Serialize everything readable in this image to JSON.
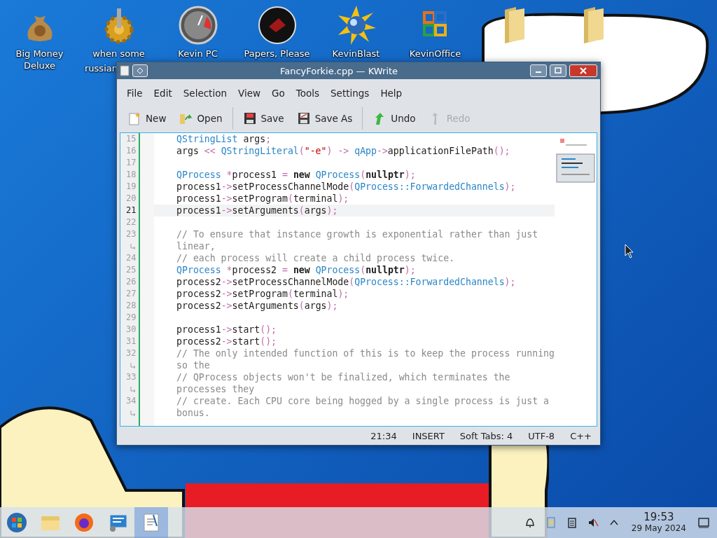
{
  "desktop_icons": [
    {
      "kind": "money-bag",
      "label": "Big Money Deluxe"
    },
    {
      "kind": "gear",
      "label_lines": [
        "when some",
        "russian"
      ]
    },
    {
      "kind": "gauge",
      "label": "Kevin PC"
    },
    {
      "kind": "dark-disc",
      "label": "Papers, Please"
    },
    {
      "kind": "sun-globe",
      "label": "KevinBlast"
    },
    {
      "kind": "office",
      "label": "KevinOffice"
    },
    {
      "kind": "folder"
    },
    {
      "kind": "folder"
    }
  ],
  "window": {
    "title": "FancyForkie.cpp — KWrite",
    "menu": [
      "File",
      "Edit",
      "Selection",
      "View",
      "Go",
      "Tools",
      "Settings",
      "Help"
    ],
    "toolbar": [
      {
        "kind": "new",
        "label": "New",
        "disabled": false
      },
      {
        "kind": "open",
        "label": "Open",
        "disabled": false
      },
      {
        "kind": "save",
        "label": "Save",
        "disabled": false,
        "separator_before": true
      },
      {
        "kind": "save-as",
        "label": "Save As",
        "disabled": false
      },
      {
        "kind": "undo",
        "label": "Undo",
        "disabled": false,
        "separator_before": true
      },
      {
        "kind": "redo",
        "label": "Redo",
        "disabled": true
      }
    ],
    "editor": {
      "lines": [
        {
          "number": "15",
          "current": false,
          "segments": [
            {
              "kind": "type",
              "text": "QStringList"
            },
            {
              "kind": "plain",
              "text": " args"
            },
            {
              "kind": "op",
              "text": ";"
            }
          ]
        },
        {
          "number": "16",
          "current": false,
          "segments": [
            {
              "kind": "plain",
              "text": "args "
            },
            {
              "kind": "op",
              "text": "<< "
            },
            {
              "kind": "type",
              "text": "QStringLiteral"
            },
            {
              "kind": "op",
              "text": "("
            },
            {
              "kind": "string",
              "text": "\"-e\""
            },
            {
              "kind": "op",
              "text": ") -> "
            },
            {
              "kind": "type",
              "text": "qApp"
            },
            {
              "kind": "op",
              "text": "->"
            },
            {
              "kind": "plain",
              "text": "applicationFilePath"
            },
            {
              "kind": "op",
              "text": "();"
            }
          ]
        },
        {
          "number": "17",
          "current": false
        },
        {
          "number": "18",
          "current": false,
          "segments": [
            {
              "kind": "type",
              "text": "QProcess "
            },
            {
              "kind": "op",
              "text": "*"
            },
            {
              "kind": "plain",
              "text": "process1 "
            },
            {
              "kind": "op",
              "text": "= "
            },
            {
              "kind": "keyword",
              "text": "new "
            },
            {
              "kind": "type",
              "text": "QProcess"
            },
            {
              "kind": "op",
              "text": "("
            },
            {
              "kind": "keyword",
              "text": "nullptr"
            },
            {
              "kind": "op",
              "text": ");"
            }
          ]
        },
        {
          "number": "19",
          "current": false,
          "segments": [
            {
              "kind": "plain",
              "text": "process1"
            },
            {
              "kind": "op",
              "text": "->"
            },
            {
              "kind": "plain",
              "text": "setProcessChannelMode"
            },
            {
              "kind": "op",
              "text": "("
            },
            {
              "kind": "type",
              "text": "QProcess::ForwardedChannels"
            },
            {
              "kind": "op",
              "text": ");"
            }
          ]
        },
        {
          "number": "20",
          "current": false,
          "segments": [
            {
              "kind": "plain",
              "text": "process1"
            },
            {
              "kind": "op",
              "text": "->"
            },
            {
              "kind": "plain",
              "text": "setProgram"
            },
            {
              "kind": "op",
              "text": "("
            },
            {
              "kind": "plain",
              "text": "terminal"
            },
            {
              "kind": "op",
              "text": ");"
            }
          ]
        },
        {
          "number": "21",
          "current": true,
          "segments": [
            {
              "kind": "plain",
              "text": "process1"
            },
            {
              "kind": "op",
              "text": "->"
            },
            {
              "kind": "plain",
              "text": "setArguments"
            },
            {
              "kind": "op",
              "text": "("
            },
            {
              "kind": "plain",
              "text": "args"
            },
            {
              "kind": "op",
              "text": ");"
            }
          ]
        },
        {
          "number": "22",
          "current": false
        },
        {
          "number": "23",
          "current": false,
          "segments": [
            {
              "kind": "comment",
              "text": "// To ensure that instance growth is exponential rather than just"
            }
          ],
          "wrap": [
            {
              "kind": "comment",
              "text": "linear,"
            }
          ]
        },
        {
          "number": "24",
          "current": false,
          "segments": [
            {
              "kind": "comment",
              "text": "// each process will create a child process twice."
            }
          ]
        },
        {
          "number": "25",
          "current": false,
          "segments": [
            {
              "kind": "type",
              "text": "QProcess "
            },
            {
              "kind": "op",
              "text": "*"
            },
            {
              "kind": "plain",
              "text": "process2 "
            },
            {
              "kind": "op",
              "text": "= "
            },
            {
              "kind": "keyword",
              "text": "new "
            },
            {
              "kind": "type",
              "text": "QProcess"
            },
            {
              "kind": "op",
              "text": "("
            },
            {
              "kind": "keyword",
              "text": "nullptr"
            },
            {
              "kind": "op",
              "text": ");"
            }
          ]
        },
        {
          "number": "26",
          "current": false,
          "segments": [
            {
              "kind": "plain",
              "text": "process2"
            },
            {
              "kind": "op",
              "text": "->"
            },
            {
              "kind": "plain",
              "text": "setProcessChannelMode"
            },
            {
              "kind": "op",
              "text": "("
            },
            {
              "kind": "type",
              "text": "QProcess::ForwardedChannels"
            },
            {
              "kind": "op",
              "text": ");"
            }
          ]
        },
        {
          "number": "27",
          "current": false,
          "segments": [
            {
              "kind": "plain",
              "text": "process2"
            },
            {
              "kind": "op",
              "text": "->"
            },
            {
              "kind": "plain",
              "text": "setProgram"
            },
            {
              "kind": "op",
              "text": "("
            },
            {
              "kind": "plain",
              "text": "terminal"
            },
            {
              "kind": "op",
              "text": ");"
            }
          ]
        },
        {
          "number": "28",
          "current": false,
          "segments": [
            {
              "kind": "plain",
              "text": "process2"
            },
            {
              "kind": "op",
              "text": "->"
            },
            {
              "kind": "plain",
              "text": "setArguments"
            },
            {
              "kind": "op",
              "text": "("
            },
            {
              "kind": "plain",
              "text": "args"
            },
            {
              "kind": "op",
              "text": ");"
            }
          ]
        },
        {
          "number": "29",
          "current": false
        },
        {
          "number": "30",
          "current": false,
          "segments": [
            {
              "kind": "plain",
              "text": "process1"
            },
            {
              "kind": "op",
              "text": "->"
            },
            {
              "kind": "plain",
              "text": "start"
            },
            {
              "kind": "op",
              "text": "();"
            }
          ]
        },
        {
          "number": "31",
          "current": false,
          "segments": [
            {
              "kind": "plain",
              "text": "process2"
            },
            {
              "kind": "op",
              "text": "->"
            },
            {
              "kind": "plain",
              "text": "start"
            },
            {
              "kind": "op",
              "text": "();"
            }
          ]
        },
        {
          "number": "32",
          "current": false,
          "segments": [
            {
              "kind": "comment",
              "text": "// The only intended function of this is to keep the process running"
            }
          ],
          "wrap": [
            {
              "kind": "comment",
              "text": "so the"
            }
          ]
        },
        {
          "number": "33",
          "current": false,
          "segments": [
            {
              "kind": "comment",
              "text": "// QProcess objects won't be finalized, which terminates the"
            }
          ],
          "wrap": [
            {
              "kind": "comment",
              "text": "processes they"
            }
          ]
        },
        {
          "number": "34",
          "current": false,
          "segments": [
            {
              "kind": "comment",
              "text": "// create. Each CPU core being hogged by a single process is just a"
            }
          ],
          "wrap": [
            {
              "kind": "comment",
              "text": "bonus."
            }
          ]
        }
      ]
    },
    "status_bar": [
      "21:34",
      "INSERT",
      "Soft Tabs: 4",
      "UTF-8",
      "C++"
    ]
  },
  "taskbar": {
    "apps": [
      {
        "kind": "start",
        "selected": false
      },
      {
        "kind": "folder",
        "selected": false
      },
      {
        "kind": "firefox",
        "selected": false
      },
      {
        "kind": "monitor",
        "selected": false
      },
      {
        "kind": "kwrite",
        "selected": true
      }
    ],
    "tray": [
      {
        "kind": "bell"
      },
      {
        "kind": "clipboard-blue"
      },
      {
        "kind": "clipboard"
      },
      {
        "kind": "volume-muted"
      },
      {
        "kind": "caret-up"
      }
    ],
    "clock": {
      "time": "19:53",
      "date": "29 May 2024"
    }
  }
}
